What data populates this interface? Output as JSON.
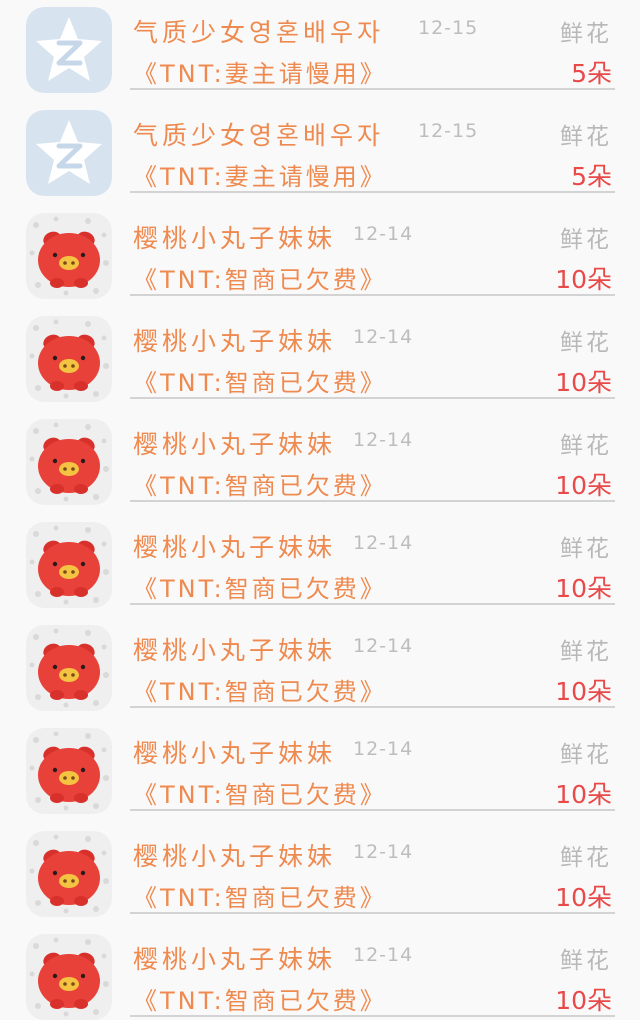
{
  "items": [
    {
      "avatar": "qzone-star-icon",
      "name": "气质少女영혼배우자",
      "date": "12-15",
      "gift": "鲜花",
      "title": "《TNT:妻主请慢用》",
      "count": "5朵"
    },
    {
      "avatar": "qzone-star-icon",
      "name": "气质少女영혼배우자",
      "date": "12-15",
      "gift": "鲜花",
      "title": "《TNT:妻主请慢用》",
      "count": "5朵"
    },
    {
      "avatar": "red-pig-icon",
      "name": "樱桃小丸子妹妹",
      "date": "12-14",
      "gift": "鲜花",
      "title": "《TNT:智商已欠费》",
      "count": "10朵"
    },
    {
      "avatar": "red-pig-icon",
      "name": "樱桃小丸子妹妹",
      "date": "12-14",
      "gift": "鲜花",
      "title": "《TNT:智商已欠费》",
      "count": "10朵"
    },
    {
      "avatar": "red-pig-icon",
      "name": "樱桃小丸子妹妹",
      "date": "12-14",
      "gift": "鲜花",
      "title": "《TNT:智商已欠费》",
      "count": "10朵"
    },
    {
      "avatar": "red-pig-icon",
      "name": "樱桃小丸子妹妹",
      "date": "12-14",
      "gift": "鲜花",
      "title": "《TNT:智商已欠费》",
      "count": "10朵"
    },
    {
      "avatar": "red-pig-icon",
      "name": "樱桃小丸子妹妹",
      "date": "12-14",
      "gift": "鲜花",
      "title": "《TNT:智商已欠费》",
      "count": "10朵"
    },
    {
      "avatar": "red-pig-icon",
      "name": "樱桃小丸子妹妹",
      "date": "12-14",
      "gift": "鲜花",
      "title": "《TNT:智商已欠费》",
      "count": "10朵"
    },
    {
      "avatar": "red-pig-icon",
      "name": "樱桃小丸子妹妹",
      "date": "12-14",
      "gift": "鲜花",
      "title": "《TNT:智商已欠费》",
      "count": "10朵"
    },
    {
      "avatar": "red-pig-icon",
      "name": "樱桃小丸子妹妹",
      "date": "12-14",
      "gift": "鲜花",
      "title": "《TNT:智商已欠费》",
      "count": "10朵"
    }
  ],
  "colors": {
    "name": "#ee8a4f",
    "date": "#bdbdbd",
    "gift": "#b8b8b8",
    "count": "#e84a4a",
    "divider": "#d3d3d3",
    "background": "#faf9f9"
  }
}
